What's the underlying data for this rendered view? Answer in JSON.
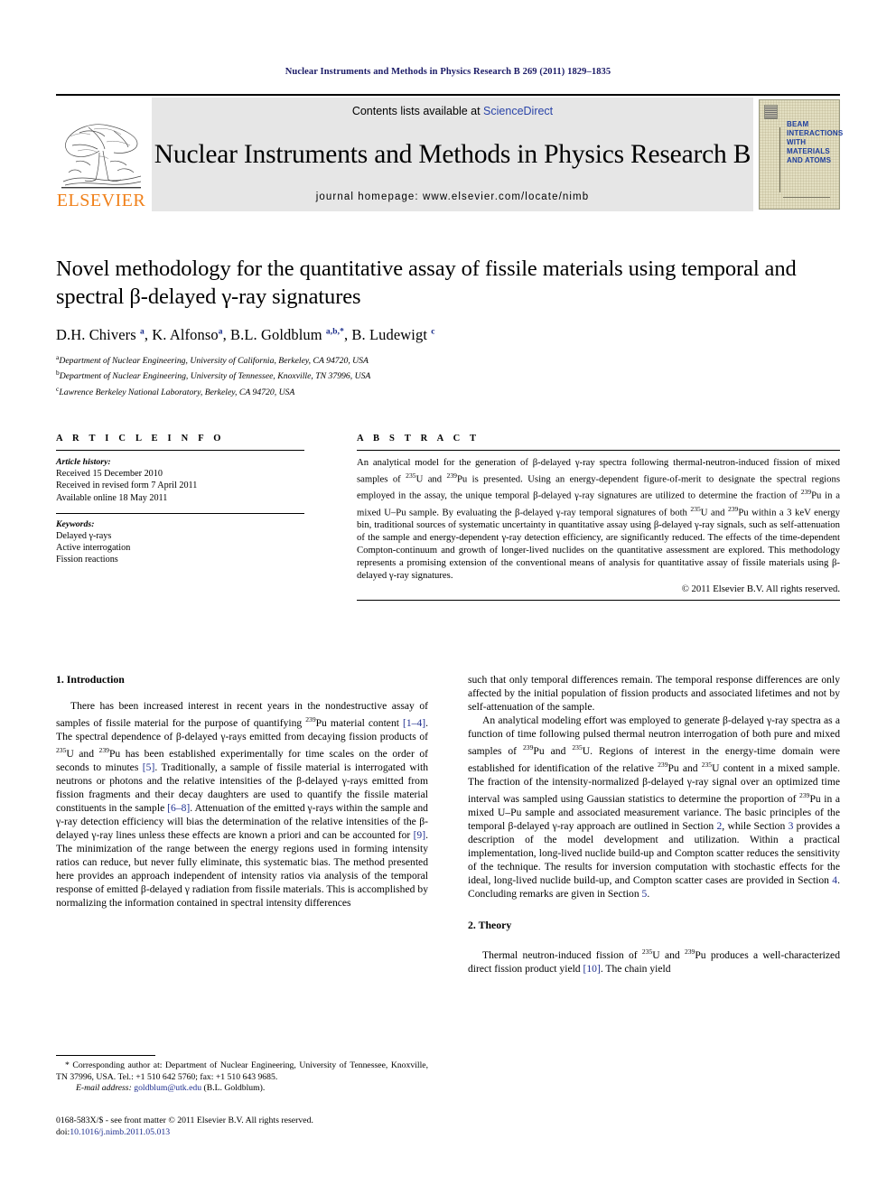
{
  "running_head": "Nuclear Instruments and Methods in Physics Research B 269 (2011) 1829–1835",
  "masthead": {
    "publisher_name": "ELSEVIER",
    "contents_prefix": "Contents lists available at ",
    "contents_link": "ScienceDirect",
    "journal_title": "Nuclear Instruments and Methods in Physics Research B",
    "homepage": "journal homepage: www.elsevier.com/locate/nimb",
    "cover_lines": [
      "BEAM",
      "INTERACTIONS",
      "WITH",
      "MATERIALS",
      "AND ATOMS"
    ],
    "link_color": "#2a44a8",
    "logo_color": "#F08019",
    "banner_bg": "#e6e6e6"
  },
  "article": {
    "title": "Novel methodology for the quantitative assay of fissile materials using temporal and spectral β-delayed γ-ray signatures",
    "authors_html": "D.H. Chivers <sup>a</sup>, K. Alfonso<sup>a</sup>, B.L. Goldblum <sup>a,b,*</sup>, B. Ludewigt <sup>c</sup>",
    "affiliations": [
      {
        "marker": "a",
        "text": "Department of Nuclear Engineering, University of California, Berkeley, CA 94720, USA"
      },
      {
        "marker": "b",
        "text": "Department of Nuclear Engineering, University of Tennessee, Knoxville, TN 37996, USA"
      },
      {
        "marker": "c",
        "text": "Lawrence Berkeley National Laboratory, Berkeley, CA 94720, USA"
      }
    ]
  },
  "article_info": {
    "heading": "A R T I C L E  I N F O",
    "history_label": "Article history:",
    "history": [
      "Received 15 December 2010",
      "Received in revised form 7 April 2011",
      "Available online 18 May 2011"
    ],
    "keywords_label": "Keywords:",
    "keywords": [
      "Delayed γ-rays",
      "Active interrogation",
      "Fission reactions"
    ]
  },
  "abstract": {
    "heading": "A B S T R A C T",
    "text_html": "An analytical model for the generation of β-delayed γ-ray spectra following thermal-neutron-induced fission of mixed samples of <sup class=\"iso\">235</sup>U and <sup class=\"iso\">239</sup>Pu is presented. Using an energy-dependent figure-of-merit to designate the spectral regions employed in the assay, the unique temporal β-delayed γ-ray signatures are utilized to determine the fraction of <sup class=\"iso\">239</sup>Pu in a mixed U–Pu sample. By evaluating the β-delayed γ-ray temporal signatures of both <sup class=\"iso\">235</sup>U and <sup class=\"iso\">239</sup>Pu within a 3 keV energy bin, traditional sources of systematic uncertainty in quantitative assay using β-delayed γ-ray signals, such as self-attenuation of the sample and energy-dependent γ-ray detection efficiency, are significantly reduced. The effects of the time-dependent Compton-continuum and growth of longer-lived nuclides on the quantitative assessment are explored. This methodology represents a promising extension of the conventional means of analysis for quantitative assay of fissile materials using β-delayed γ-ray signatures.",
    "copyright": "© 2011 Elsevier B.V. All rights reserved."
  },
  "body": {
    "left_heading": "1. Introduction",
    "left_paragraph_html": "There has been increased interest in recent years in the nondestructive assay of samples of fissile material for the purpose of quantifying <sup class=\"iso\">239</sup>Pu material content <span class=\"ref\">[1–4]</span>. The spectral dependence of β-delayed γ-rays emitted from decaying fission products of <sup class=\"iso\">235</sup>U and <sup class=\"iso\">239</sup>Pu has been established experimentally for time scales on the order of seconds to minutes <span class=\"ref\">[5]</span>. Traditionally, a sample of fissile material is interrogated with neutrons or photons and the relative intensities of the β-delayed γ-rays emitted from fission fragments and their decay daughters are used to quantify the fissile material constituents in the sample <span class=\"ref\">[6–8]</span>. Attenuation of the emitted γ-rays within the sample and γ-ray detection efficiency will bias the determination of the relative intensities of the β-delayed γ-ray lines unless these effects are known a priori and can be accounted for <span class=\"ref\">[9]</span>. The minimization of the range between the energy regions used in forming intensity ratios can reduce, but never fully eliminate, this systematic bias. The method presented here provides an approach independent of intensity ratios via analysis of the temporal response of emitted β-delayed γ radiation from fissile materials. This is accomplished by normalizing the information contained in spectral intensity differences",
    "right_paragraph_1_html": "such that only temporal differences remain. The temporal response differences are only affected by the initial population of fission products and associated lifetimes and not by self-attenuation of the sample.",
    "right_paragraph_2_html": "An analytical modeling effort was employed to generate β-delayed γ-ray spectra as a function of time following pulsed thermal neutron interrogation of both pure and mixed samples of <sup class=\"iso\">239</sup>Pu and <sup class=\"iso\">235</sup>U. Regions of interest in the energy-time domain were established for identification of the relative <sup class=\"iso\">239</sup>Pu and <sup class=\"iso\">235</sup>U content in a mixed sample. The fraction of the intensity-normalized β-delayed γ-ray signal over an optimized time interval was sampled using Gaussian statistics to determine the proportion of <sup class=\"iso\">239</sup>Pu in a mixed U–Pu sample and associated measurement variance. The basic principles of the temporal β-delayed γ-ray approach are outlined in Section <span class=\"ref\">2</span>, while Section <span class=\"ref\">3</span> provides a description of the model development and utilization. Within a practical implementation, long-lived nuclide build-up and Compton scatter reduces the sensitivity of the technique. The results for inversion computation with stochastic effects for the ideal, long-lived nuclide build-up, and Compton scatter cases are provided in Section <span class=\"ref\">4</span>. Concluding remarks are given in Section <span class=\"ref\">5</span>.",
    "right_heading": "2. Theory",
    "right_paragraph_3_html": "Thermal neutron-induced fission of <sup class=\"iso\">235</sup>U and <sup class=\"iso\">239</sup>Pu produces a well-characterized direct fission product yield <span class=\"ref\">[10]</span>. The chain yield"
  },
  "footnote": {
    "corresponding_html": "* Corresponding author at: Department of Nuclear Engineering, University of Tennessee, Knoxville, TN 37996, USA. Tel.: +1 510 642 5760; fax: +1 510 643 9685.",
    "email_label": "E-mail address:",
    "email": "goldblum@utk.edu",
    "email_owner": "(B.L. Goldblum)."
  },
  "imprint": {
    "line1": "0168-583X/$ - see front matter © 2011 Elsevier B.V. All rights reserved.",
    "doi_label": "doi:",
    "doi": "10.1016/j.nimb.2011.05.013"
  }
}
